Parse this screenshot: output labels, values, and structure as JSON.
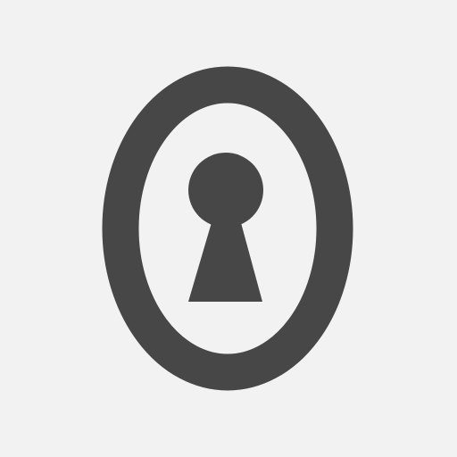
{
  "icon": {
    "name": "keyhole-lock-icon",
    "colors": {
      "background": "#f2f2f2",
      "foreground": "#474747"
    }
  }
}
